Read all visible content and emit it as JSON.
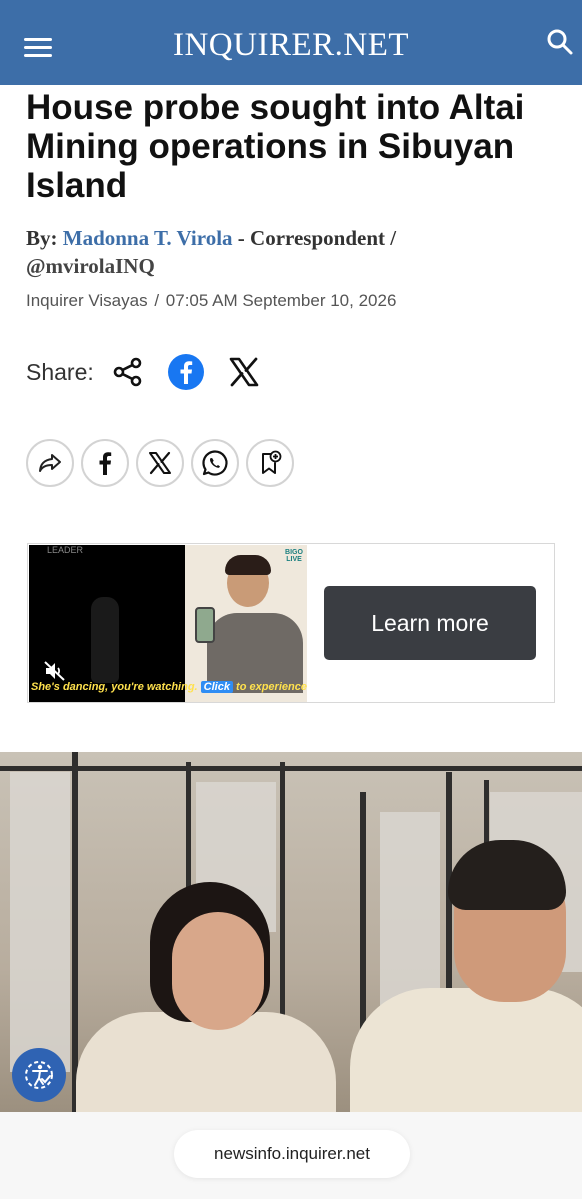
{
  "header": {
    "brand": "INQUIRER.NET",
    "menu_icon": "hamburger-menu-icon",
    "search_icon": "search-icon",
    "background_color": "#3d6ea8"
  },
  "article": {
    "headline": "House probe sought into Altai Mining operations in Sibuyan Island",
    "byline_prefix": "By:",
    "author": "Madonna T. Virola",
    "role": " - Correspondent /",
    "handle": "@mvirolaINQ",
    "section": "Inquirer Visayas",
    "separator": "/",
    "timestamp": "07:05 AM September 10, 2026"
  },
  "share": {
    "label": "Share:",
    "icons": [
      "share-icon",
      "facebook-icon",
      "x-icon"
    ]
  },
  "actions": {
    "icons": [
      "forward-icon",
      "facebook-icon",
      "x-icon",
      "whatsapp-icon",
      "bookmark-add-icon"
    ]
  },
  "ad": {
    "caption_lead": "She's dancing, you're watching.",
    "caption_click": "Click",
    "caption_rest": "to experience!",
    "brand": "BIGO LIVE",
    "corner_text": "LEADER",
    "button_label": "Learn more"
  },
  "photo": {
    "accessibility_icon": "accessibility-icon"
  },
  "browser": {
    "url": "newsinfo.inquirer.net"
  }
}
